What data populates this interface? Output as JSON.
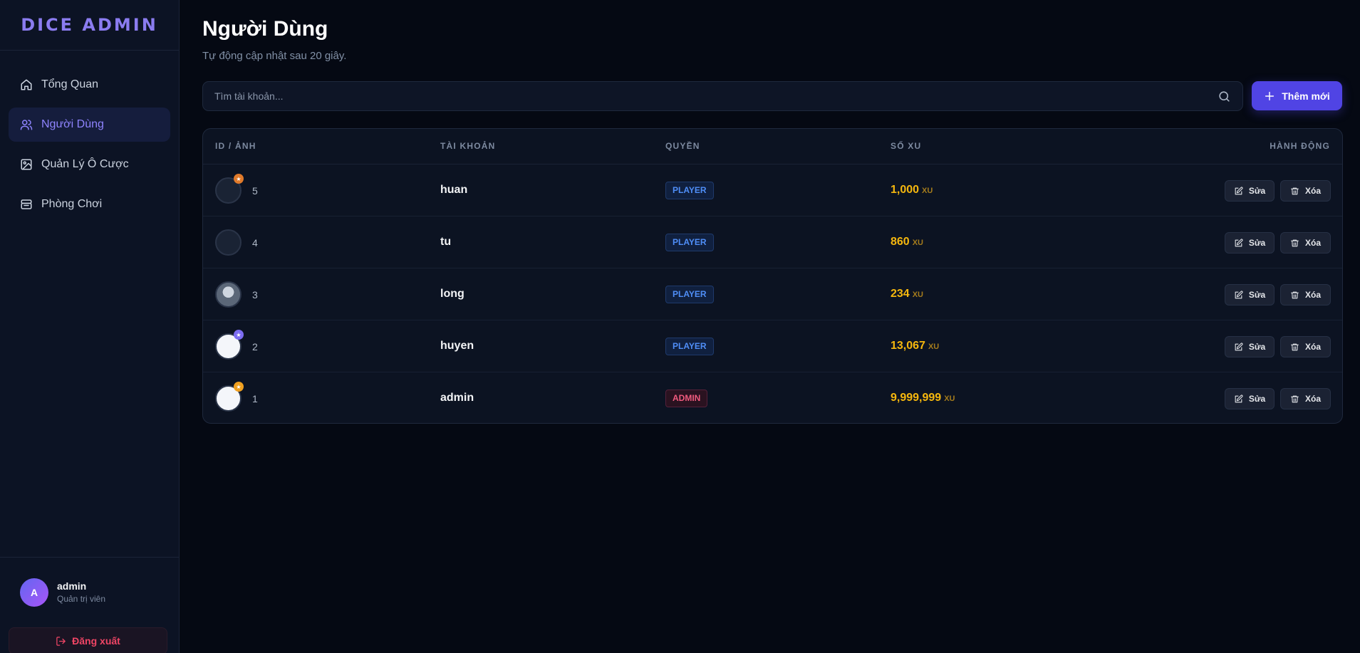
{
  "sidebar": {
    "brand": "DICE ADMIN",
    "items": [
      {
        "label": "Tổng Quan",
        "icon": "home-icon",
        "active": false
      },
      {
        "label": "Người Dùng",
        "icon": "users-icon",
        "active": true
      },
      {
        "label": "Quản Lý Ô Cược",
        "icon": "image-icon",
        "active": false
      },
      {
        "label": "Phòng Chơi",
        "icon": "box-icon",
        "active": false
      }
    ],
    "user": {
      "initial": "A",
      "name": "admin",
      "role": "Quản trị viên"
    },
    "logout_label": "Đăng xuất"
  },
  "page": {
    "title": "Người Dùng",
    "subtitle": "Tự động cập nhật sau 20 giây."
  },
  "search": {
    "placeholder": "Tìm tài khoản...",
    "value": ""
  },
  "add_button": {
    "label": "Thêm mới"
  },
  "table": {
    "headers": [
      "ID / ẢNH",
      "TÀI KHOẢN",
      "QUYỀN",
      "SỐ XU",
      "HÀNH ĐỘNG"
    ],
    "edit_label": "Sửa",
    "delete_label": "Xóa",
    "currency_unit": "XU",
    "rows": [
      {
        "id": "5",
        "account": "huan",
        "role": "PLAYER",
        "coins": "1,000"
      },
      {
        "id": "4",
        "account": "tu",
        "role": "PLAYER",
        "coins": "860"
      },
      {
        "id": "3",
        "account": "long",
        "role": "PLAYER",
        "coins": "234"
      },
      {
        "id": "2",
        "account": "huyen",
        "role": "PLAYER",
        "coins": "13,067"
      },
      {
        "id": "1",
        "account": "admin",
        "role": "ADMIN",
        "coins": "9,999,999"
      }
    ]
  },
  "colors": {
    "accent": "#5044e4",
    "active_nav": "#8f84ff",
    "coins": "#f5b70e",
    "player_badge": "#4f8ef7",
    "admin_badge": "#f05a7e",
    "logout": "#ef4565"
  }
}
